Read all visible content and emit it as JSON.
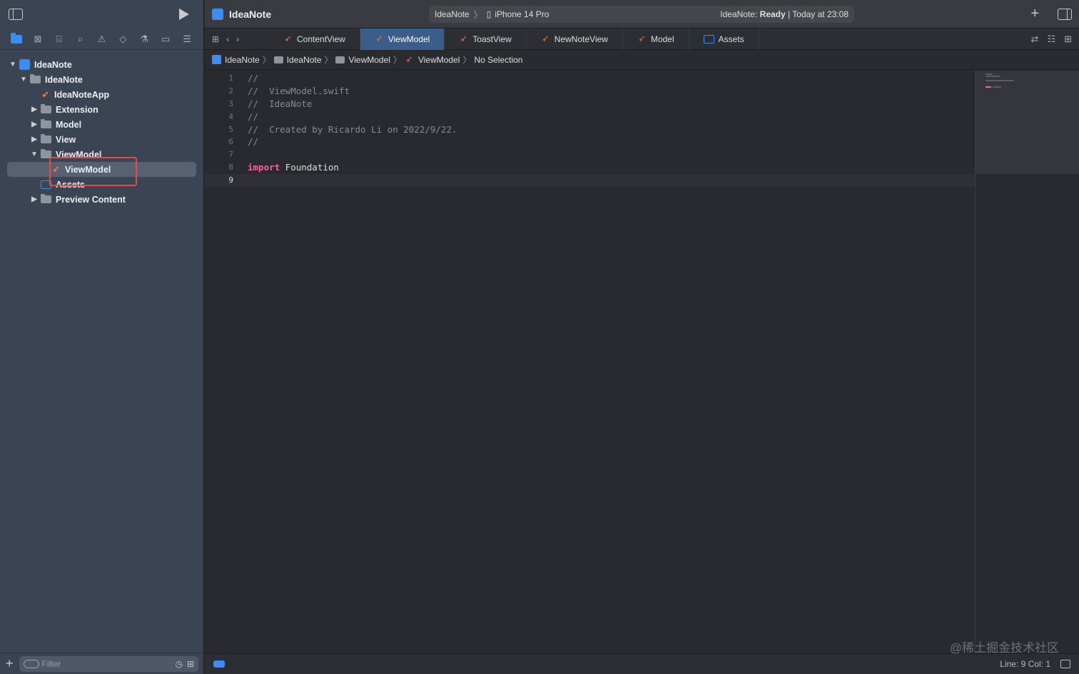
{
  "window": {
    "project_title": "IdeaNote",
    "scheme_target": "IdeaNote",
    "scheme_device": "iPhone 14 Pro",
    "status_prefix": "IdeaNote: ",
    "status_state": "Ready",
    "status_time": "| Today at 23:08"
  },
  "sidebar": {
    "tree": [
      {
        "label": "IdeaNote",
        "type": "project",
        "expanded": true
      },
      {
        "label": "IdeaNote",
        "type": "folder",
        "expanded": true
      },
      {
        "label": "IdeaNoteApp",
        "type": "swift"
      },
      {
        "label": "Extension",
        "type": "folder",
        "expanded": false
      },
      {
        "label": "Model",
        "type": "folder",
        "expanded": false
      },
      {
        "label": "View",
        "type": "folder",
        "expanded": false
      },
      {
        "label": "ViewModel",
        "type": "folder",
        "expanded": true
      },
      {
        "label": "ViewModel",
        "type": "swift",
        "selected": true
      },
      {
        "label": "Assets",
        "type": "assets"
      },
      {
        "label": "Preview Content",
        "type": "folder",
        "expanded": false
      }
    ],
    "filter_placeholder": "Filter"
  },
  "tabs": [
    {
      "label": "ContentView",
      "icon": "swift-icon"
    },
    {
      "label": "ViewModel",
      "icon": "swift-icon",
      "active": true
    },
    {
      "label": "ToastView",
      "icon": "swift-icon"
    },
    {
      "label": "NewNoteView",
      "icon": "swift-icon"
    },
    {
      "label": "Model",
      "icon": "swift-icon"
    },
    {
      "label": "Assets",
      "icon": "assets-icon"
    }
  ],
  "jumpbar": {
    "items": [
      "IdeaNote",
      "IdeaNote",
      "ViewModel",
      "ViewModel",
      "No Selection"
    ]
  },
  "editor": {
    "line_numbers": [
      "1",
      "2",
      "3",
      "4",
      "5",
      "6",
      "7",
      "8",
      "9"
    ],
    "lines": [
      "//",
      "//  ViewModel.swift",
      "//  IdeaNote",
      "//",
      "//  Created by Ricardo Li on 2022/9/22.",
      "//",
      "",
      "import",
      ""
    ],
    "line8_rest": " Foundation"
  },
  "statusbar": {
    "position": "Line: 9  Col: 1"
  },
  "watermark": "@稀土掘金技术社区",
  "colors": {
    "accent": "#3b8cf5",
    "keyword": "#fc5fa3",
    "swift": "#f0773f",
    "highlight_box": "#e04b4b"
  }
}
